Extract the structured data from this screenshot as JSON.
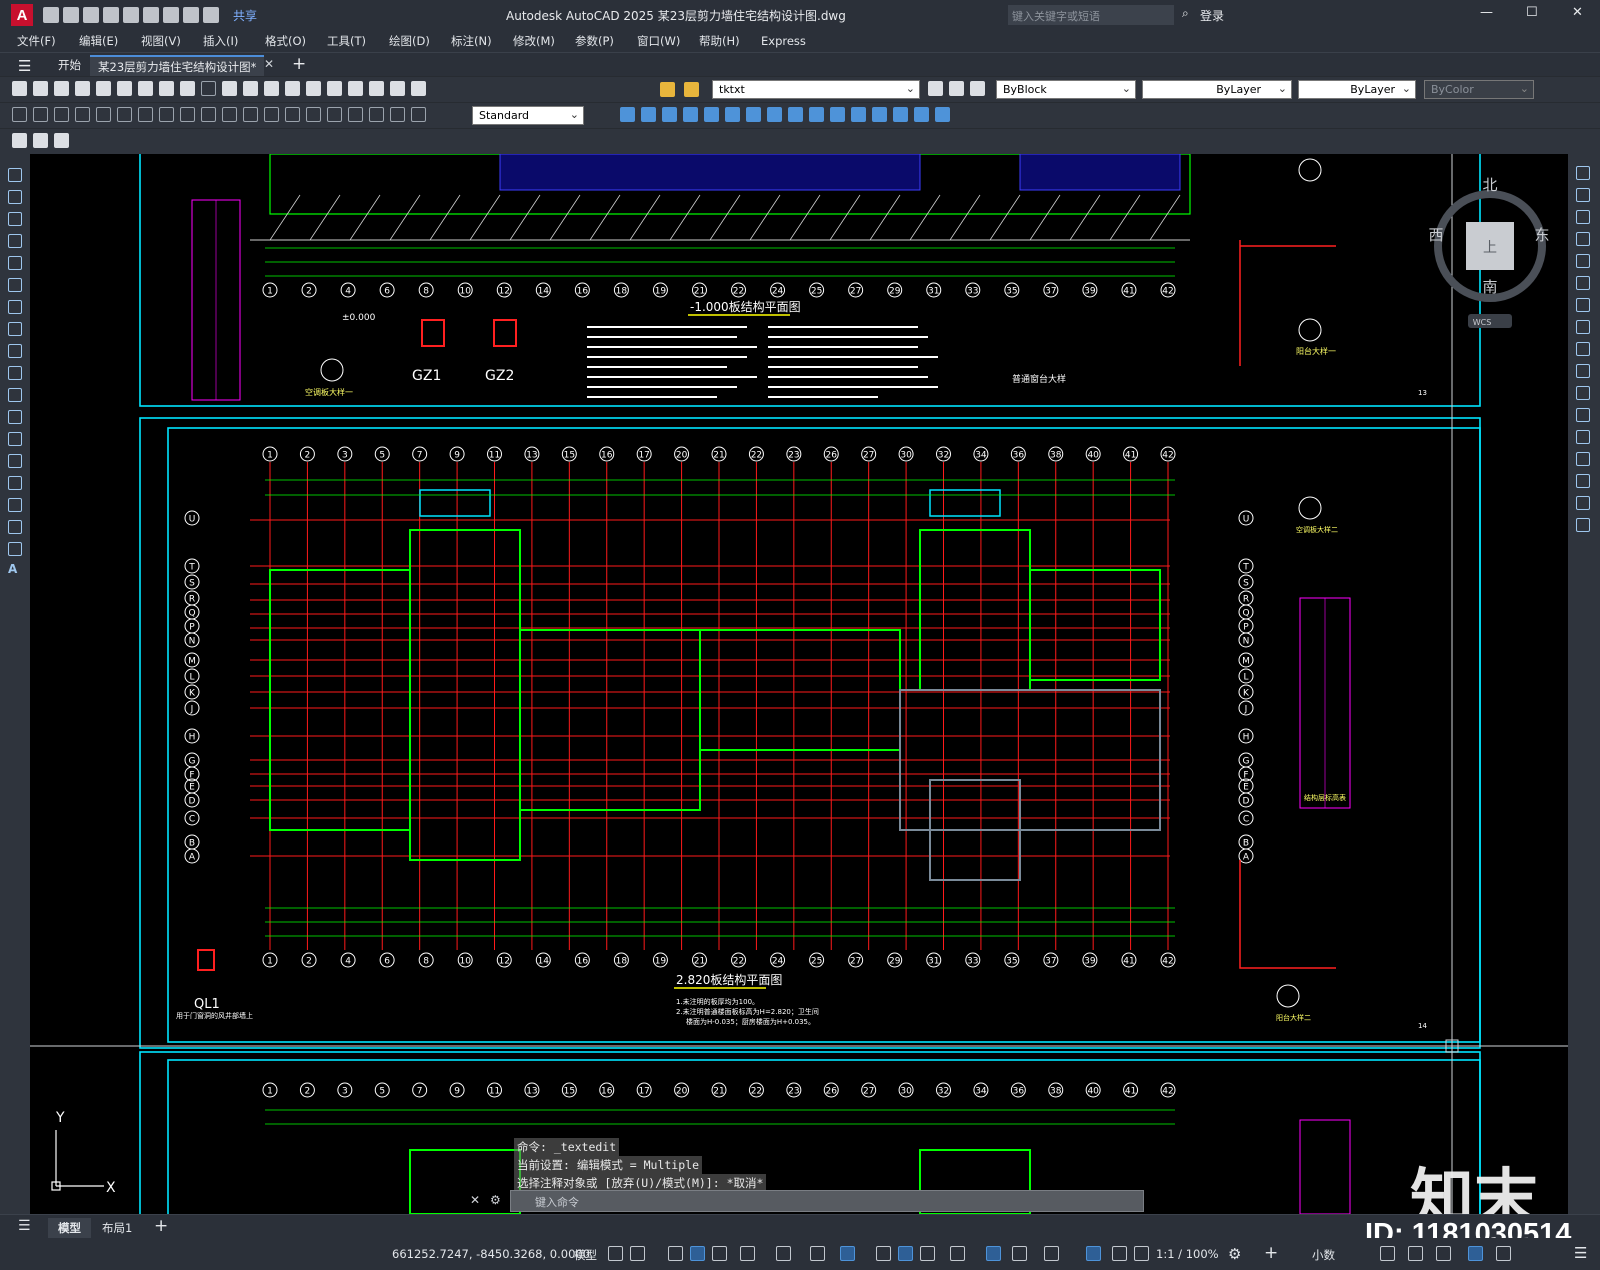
{
  "titlebar": {
    "app_logo": "A",
    "title": "Autodesk AutoCAD 2025    某23层剪力墙住宅结构设计图.dwg",
    "share": "共享",
    "search_placeholder": "键入关键字或短语",
    "login": "登录"
  },
  "menus": [
    "文件(F)",
    "编辑(E)",
    "视图(V)",
    "插入(I)",
    "格式(O)",
    "工具(T)",
    "绘图(D)",
    "标注(N)",
    "修改(M)",
    "参数(P)",
    "窗口(W)",
    "帮助(H)",
    "Express"
  ],
  "tabs": {
    "start": "开始",
    "doc": "某23层剪力墙住宅结构设计图*"
  },
  "toolbar": {
    "layer_name": "tktxt",
    "text_style": "Standard",
    "color": "ByBlock",
    "linetype": "ByLayer",
    "lineweight": "ByLayer",
    "plotstyle": "ByColor"
  },
  "viewcube": {
    "north": "北",
    "south": "南",
    "west": "西",
    "east": "东",
    "top": "上",
    "ucs": "WCS"
  },
  "drawing": {
    "plan1_title": "-1.000板结构平面图",
    "plan2_title": "2.820板结构平面图",
    "gz1": "GZ1",
    "gz2": "GZ2",
    "ql1": "QL1",
    "ql1_note": "用于门窗洞的风井部墙上",
    "detail_note": "普通窗台大样",
    "detail1": "空调板大样一",
    "detail2": "阳台大样一",
    "detail3": "空调板大样二",
    "detail4": "阳台大样二",
    "table_title": "结构层标高表",
    "level_mark": "±0.000",
    "page13": "13",
    "page14": "14",
    "grid_top": [
      "1",
      "2",
      "3",
      "5",
      "7",
      "9",
      "11",
      "13",
      "15",
      "16",
      "17",
      "20",
      "21",
      "22",
      "23",
      "26",
      "27",
      "30",
      "32",
      "34",
      "36",
      "38",
      "40",
      "41",
      "42"
    ],
    "grid_bottom": [
      "1",
      "2",
      "4",
      "6",
      "8",
      "10",
      "12",
      "14",
      "16",
      "18",
      "19",
      "21",
      "22",
      "24",
      "25",
      "27",
      "29",
      "31",
      "33",
      "35",
      "37",
      "39",
      "41",
      "42"
    ],
    "grid_side": [
      "U",
      "T",
      "S",
      "R",
      "Q",
      "P",
      "N",
      "M",
      "L",
      "K",
      "J",
      "H",
      "G",
      "F",
      "E",
      "D",
      "C",
      "B",
      "A"
    ],
    "note2a": "1.未注明的板厚均为100。",
    "note2b": "2.未注明普通楼面板标高为H=2.820；卫生间",
    "note2c": "楼面为H-0.035；厨房楼面为H+0.035。"
  },
  "command": {
    "line1": "命令: _textedit",
    "line2": "当前设置: 编辑模式 = Multiple",
    "line3": "选择注释对象或 [放弃(U)/模式(M)]: *取消*",
    "input_placeholder": "键入命令"
  },
  "layout_tabs": {
    "model": "模型",
    "layout1": "布局1"
  },
  "status": {
    "coords": "661252.7247, -8450.3268, 0.0000",
    "model": "模型",
    "scale": "1:1 / 100%",
    "units": "小数"
  },
  "watermark": {
    "id": "ID: 1181030514",
    "logo": "知末"
  }
}
